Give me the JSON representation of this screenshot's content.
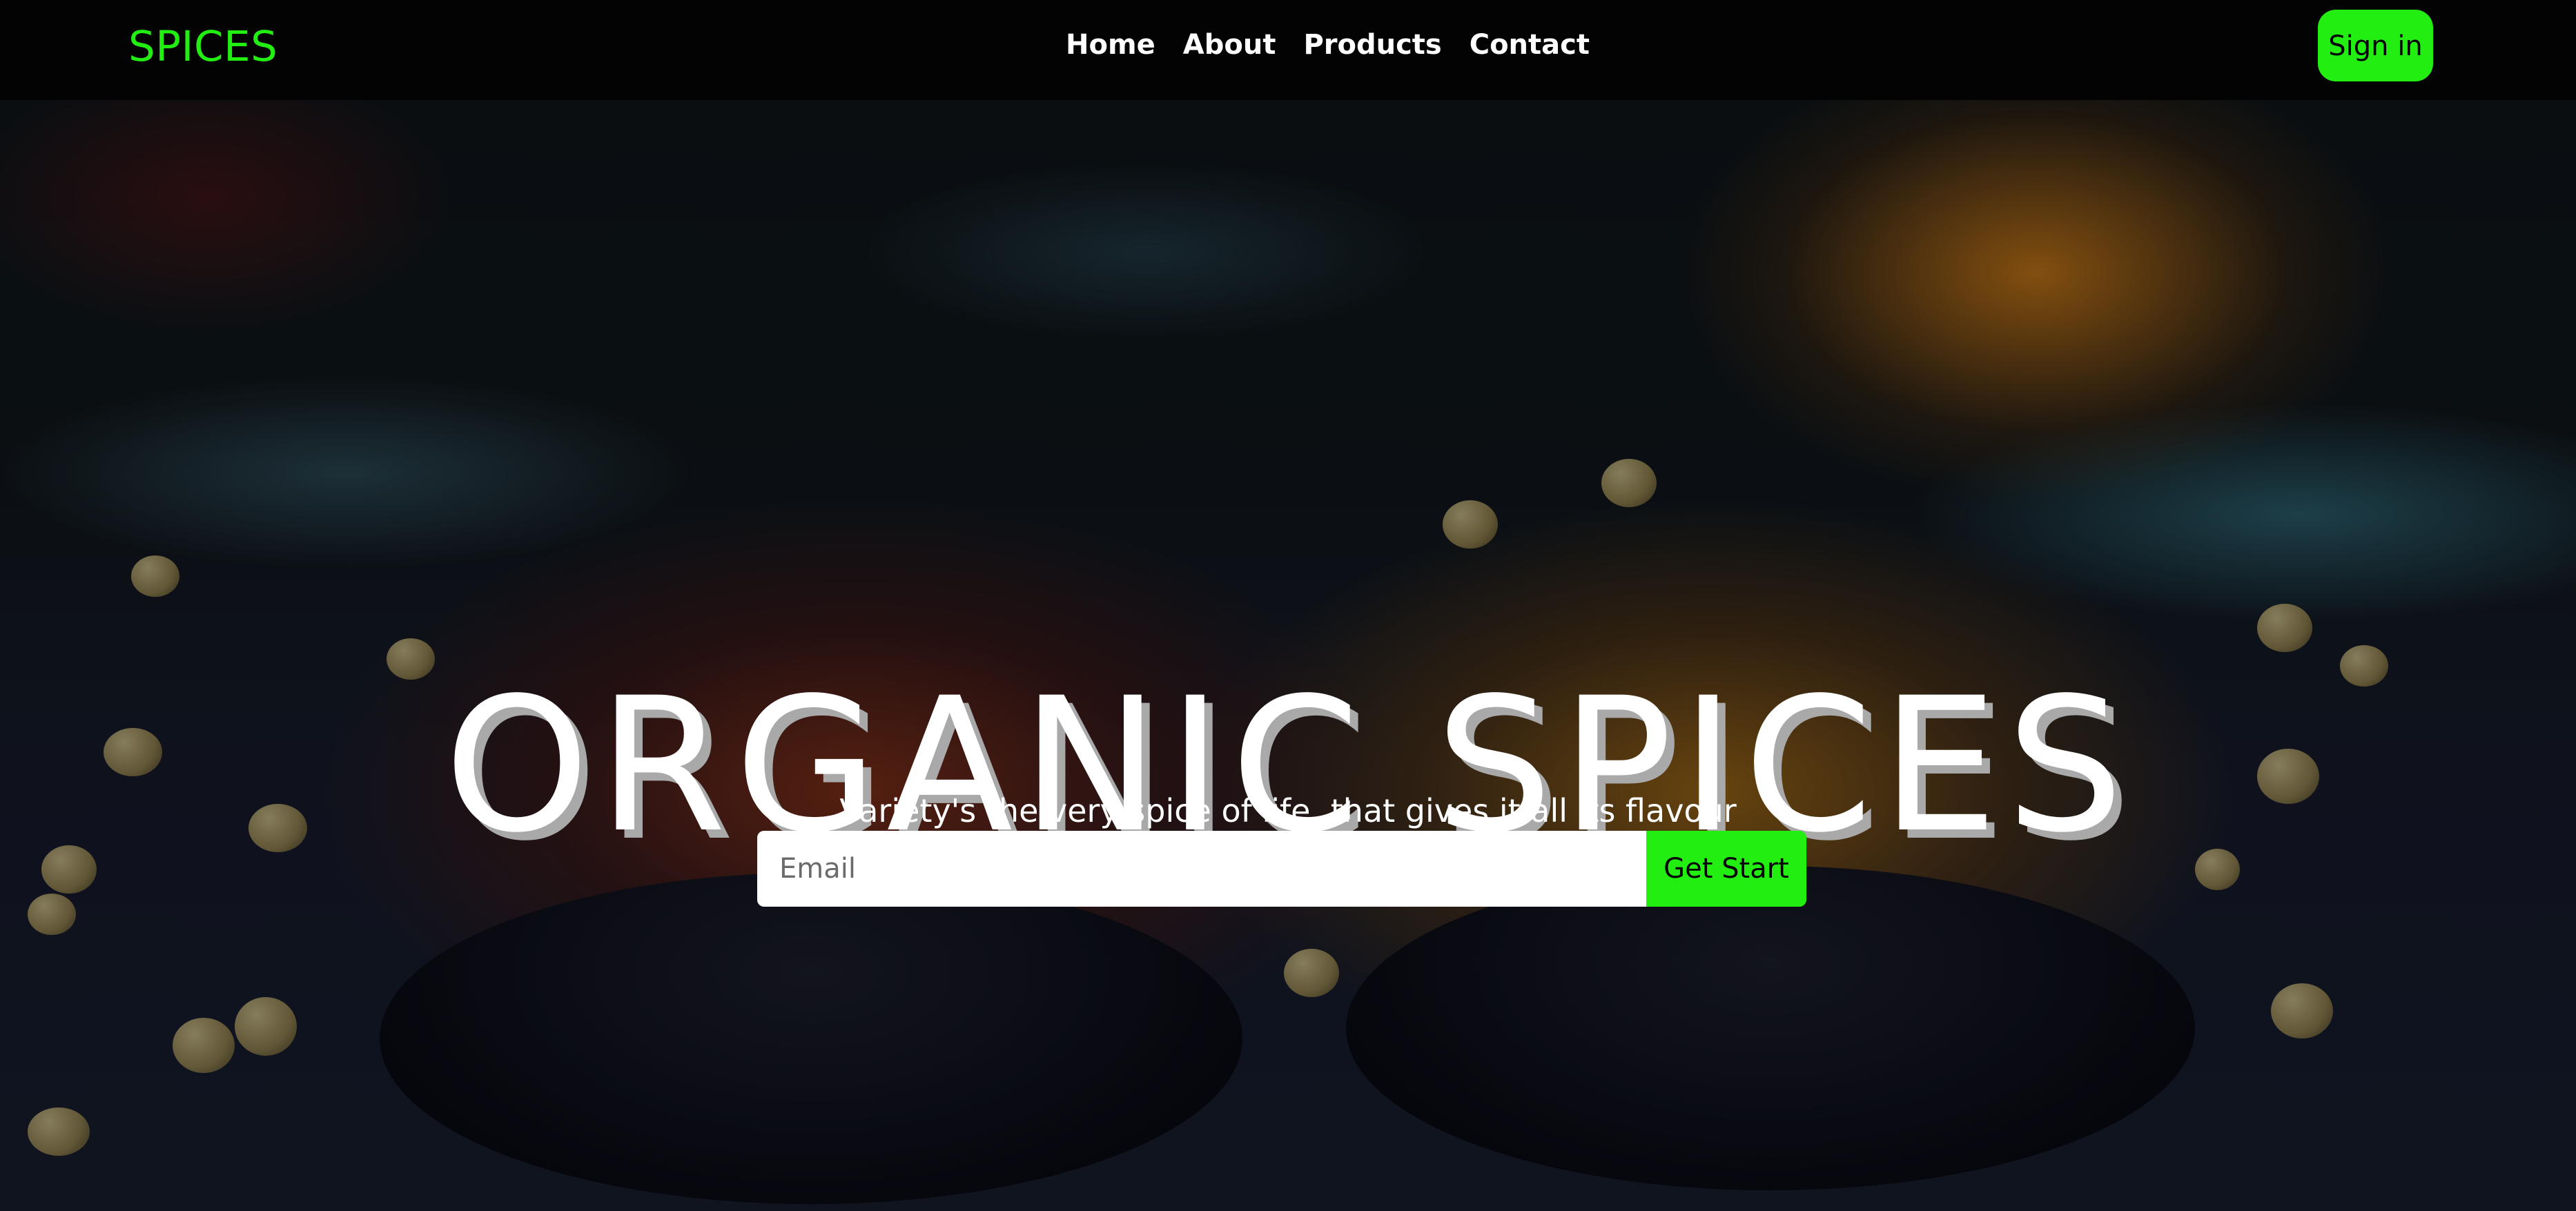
{
  "navbar": {
    "brand": "SPICES",
    "links": [
      "Home",
      "About",
      "Products",
      "Contact"
    ],
    "sign_in": "Sign in"
  },
  "hero": {
    "headline": "ORGANIC SPICES",
    "tagline": "Variety's the very spice of life, that gives it all its flavour",
    "email_placeholder": "Email",
    "cta": "Get Start"
  },
  "colors": {
    "accent": "#22ee11",
    "navbar_bg": "#030303",
    "text_light": "#ffffff"
  }
}
